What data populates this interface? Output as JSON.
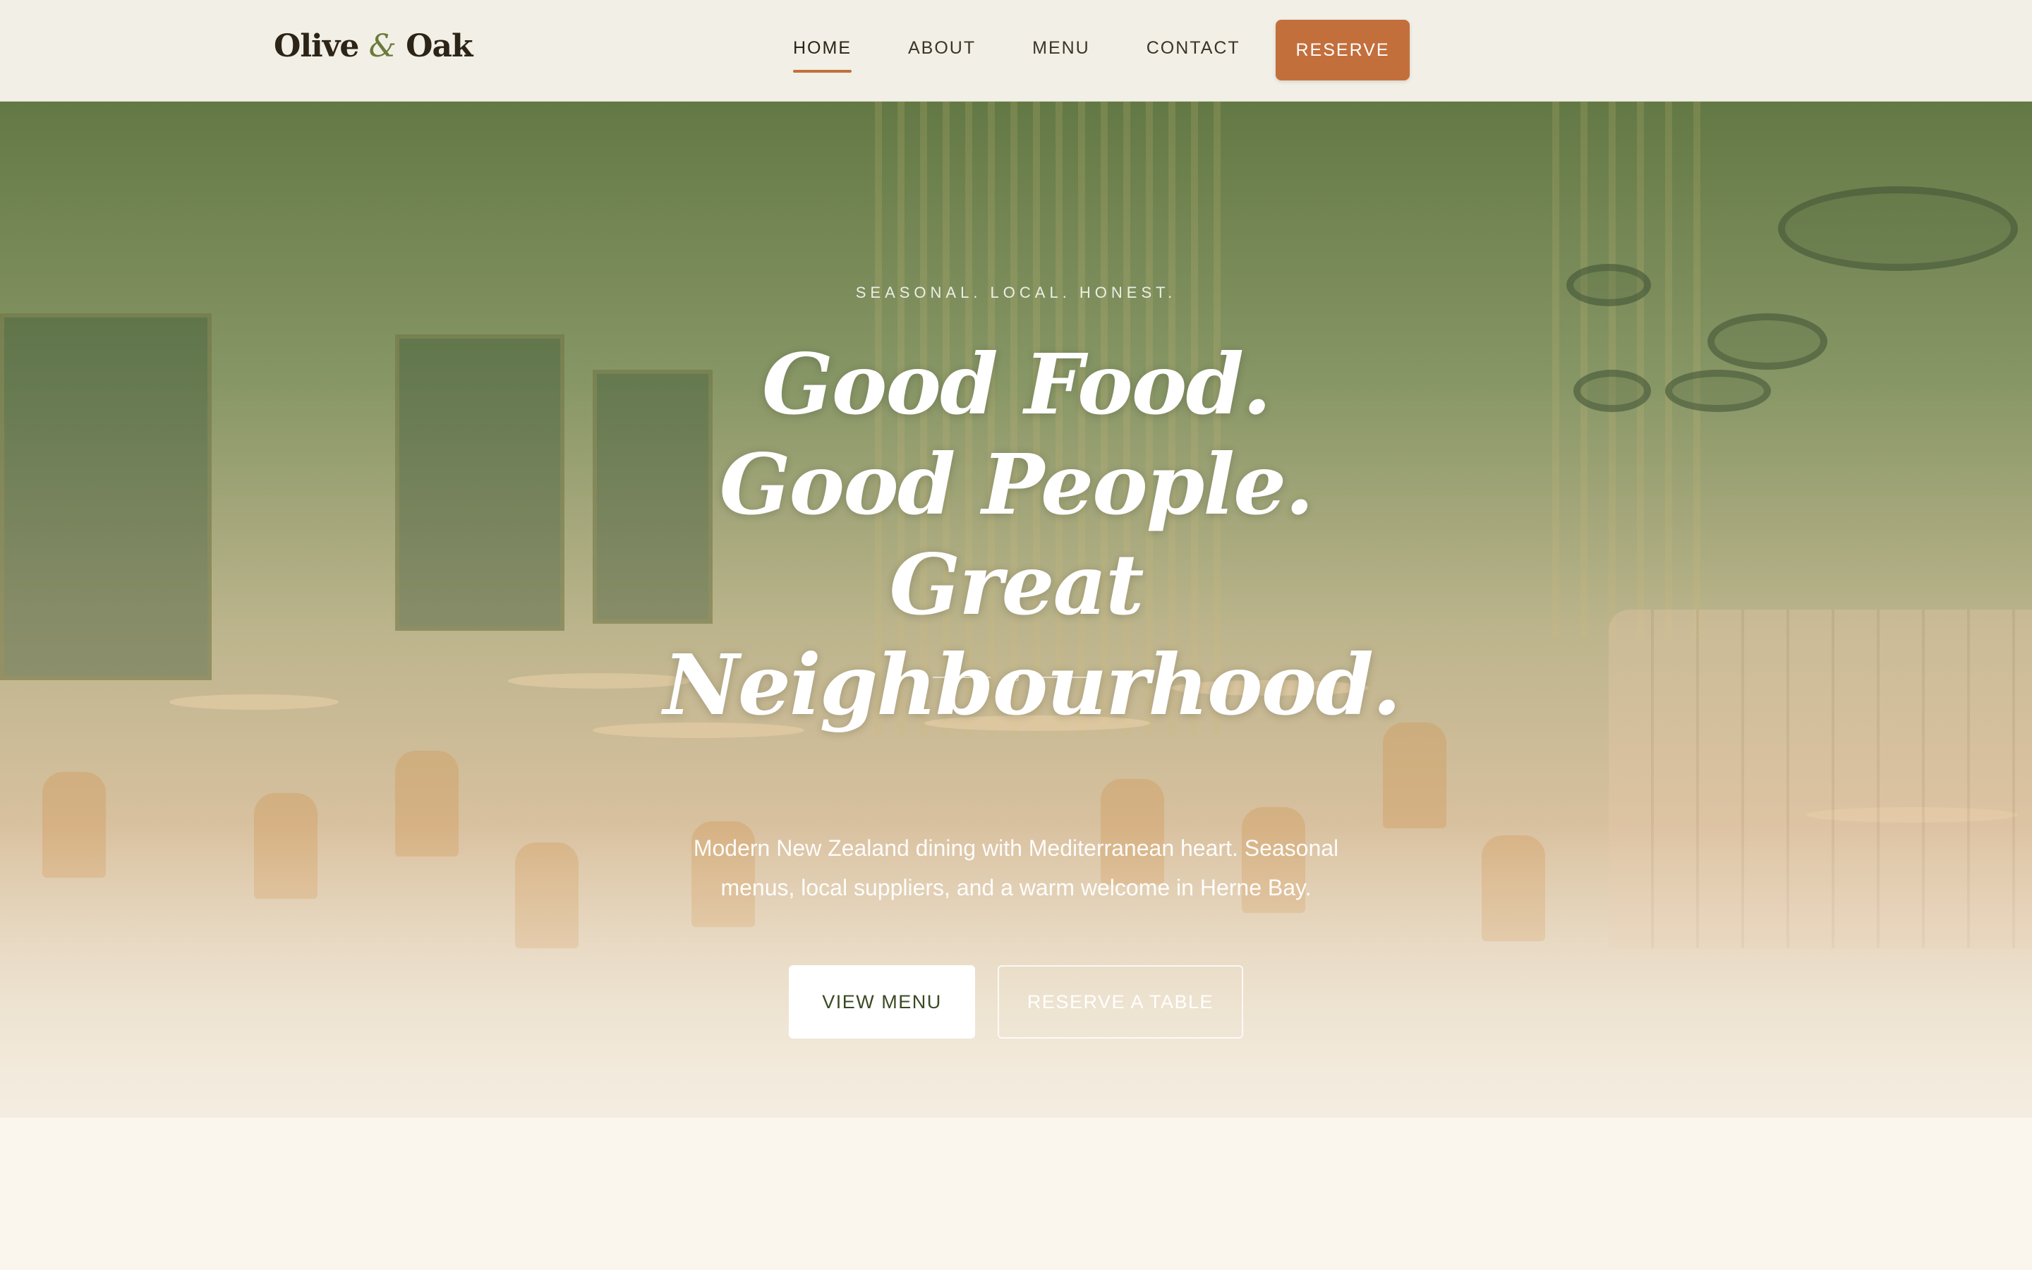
{
  "brand": {
    "name_part1": "Olive",
    "ampersand": "&",
    "name_part2": "Oak",
    "accent_color": "#c36f3c",
    "olive_color": "#6b7a3a"
  },
  "nav": {
    "items": [
      {
        "label": "HOME",
        "active": true
      },
      {
        "label": "ABOUT",
        "active": false
      },
      {
        "label": "MENU",
        "active": false
      },
      {
        "label": "CONTACT",
        "active": false
      }
    ],
    "reserve_label": "RESERVE"
  },
  "hero": {
    "eyebrow": "SEASONAL. LOCAL. HONEST.",
    "headline": "Good Food. Good People. Great Neighbourhood.",
    "divider_icon": "olive-sprig-icon",
    "subtitle": "Modern New Zealand dining with Mediterranean heart. Seasonal menus, local suppliers, and a warm welcome in Herne Bay.",
    "primary_cta": "VIEW MENU",
    "secondary_cta": "RESERVE A TABLE"
  }
}
